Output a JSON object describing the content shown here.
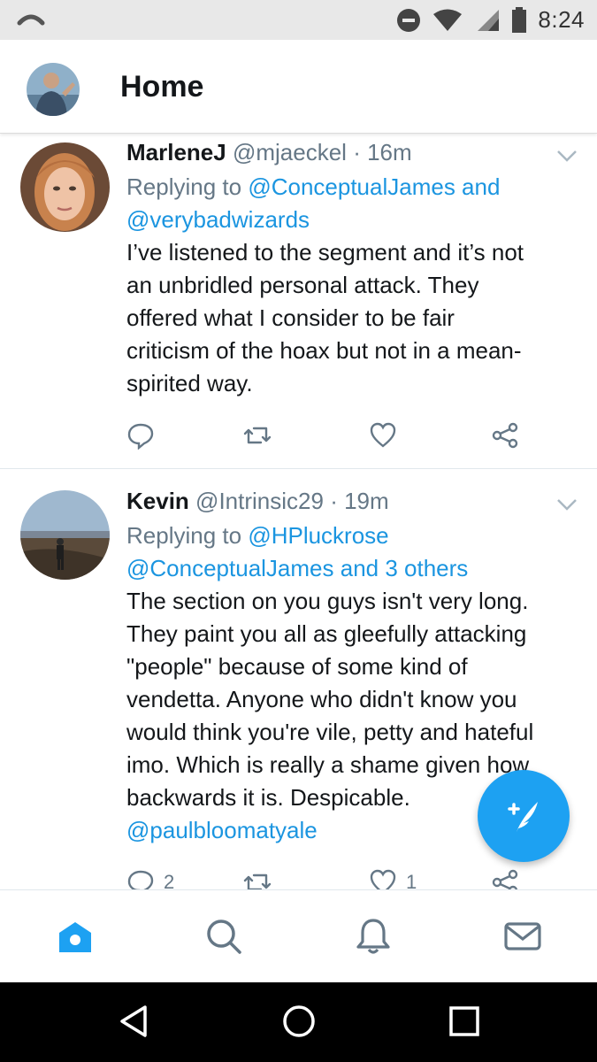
{
  "status_bar": {
    "time": "8:24",
    "icons": [
      "notification-arc-icon",
      "do-not-disturb-icon",
      "wifi-icon",
      "signal-icon",
      "battery-icon"
    ]
  },
  "header": {
    "title": "Home",
    "avatar": "profile-avatar"
  },
  "tweets": [
    {
      "name": "MarleneJ",
      "handle": "@mjaeckel",
      "dot": "·",
      "time": "16m",
      "reply_prefix": "Replying to ",
      "reply_mention_1": "@ConceptualJames",
      "reply_and": " and",
      "reply_mention_2": "@verybadwizards",
      "text_lines": [
        "I’ve listened to the segment and it’s not",
        "an unbridled personal attack. They",
        "offered what I consider to be fair",
        "criticism of the hoax but not in a mean-",
        "spirited way."
      ],
      "actions": {
        "reply_count": "",
        "retweet_count": "",
        "like_count": ""
      }
    },
    {
      "name": "Kevin",
      "handle": "@Intrinsic29",
      "dot": "·",
      "time": "19m",
      "reply_prefix": "Replying to ",
      "reply_mention_1": "@HPluckrose",
      "reply_line2": "@ConceptualJames and 3 others",
      "text_lines": [
        "The section on you guys isn't very long.",
        "They paint you all as gleefully attacking",
        "\"people\" because of some kind of",
        "vendetta. Anyone who didn't know you",
        "would think you're vile, petty and hateful",
        "imo. Which is really a shame given how",
        "backwards it is. Despicable."
      ],
      "mention_line": "@paulbloomatyale",
      "actions": {
        "reply_count": "2",
        "retweet_count": "",
        "like_count": "1"
      }
    }
  ],
  "tabs": [
    "home-icon",
    "search-icon",
    "notifications-bell-icon",
    "messages-envelope-icon"
  ],
  "fab": {
    "icon": "compose-tweet-icon"
  },
  "colors": {
    "accent": "#1da1f2",
    "link": "#1b95e0",
    "muted": "#657786",
    "text": "#14171a"
  }
}
